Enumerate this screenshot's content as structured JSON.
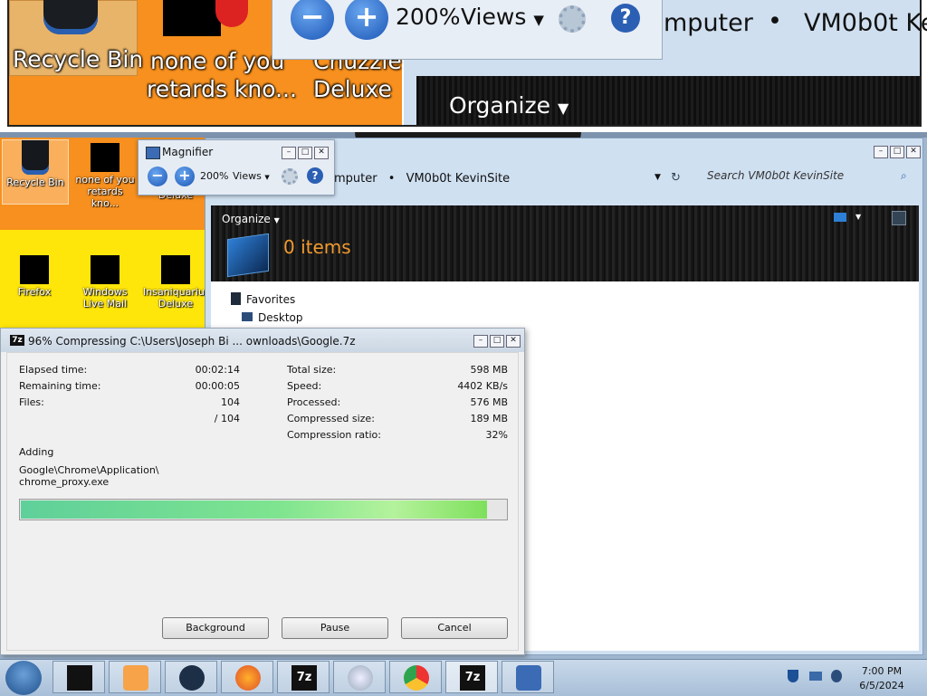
{
  "magnified": {
    "recycle_bin_label": "Recycle Bin",
    "none_of_you_label_1": "none of you",
    "none_of_you_label_2": "retards kno...",
    "chuzzle_label_1": "Chuzzle",
    "chuzzle_label_2": "Deluxe",
    "zoom": "200%",
    "views": "Views",
    "address_part": "mputer",
    "address_sep": "•",
    "address_site": "VM0b0t Ke",
    "organize": "Organize"
  },
  "desktop": {
    "icons": [
      {
        "label": "Recycle Bin"
      },
      {
        "label": "none of you retards kno..."
      },
      {
        "label": "Chuzzle Deluxe"
      },
      {
        "label": "Firefox"
      },
      {
        "label": "Windows Live Mail"
      },
      {
        "label": "Insaniquarium Deluxe"
      }
    ]
  },
  "magnifier": {
    "title": "Magnifier",
    "zoom": "200%",
    "views": "Views"
  },
  "explorer": {
    "address_part": "mputer",
    "address_sep": "•",
    "address_site": "VM0b0t KevinSite",
    "search_placeholder": "Search VM0b0t KevinSite",
    "organize": "Organize",
    "items_count": "0 items",
    "favorites": "Favorites",
    "desktop": "Desktop"
  },
  "zip": {
    "title": "96% Compressing C:\\Users\\Joseph Bi ... ownloads\\Google.7z",
    "elapsed_label": "Elapsed time:",
    "elapsed_value": "00:02:14",
    "remaining_label": "Remaining time:",
    "remaining_value": "00:00:05",
    "files_label": "Files:",
    "files_value": "104",
    "files_total": "/ 104",
    "total_size_label": "Total size:",
    "total_size_value": "598 MB",
    "speed_label": "Speed:",
    "speed_value": "4402 KB/s",
    "processed_label": "Processed:",
    "processed_value": "576 MB",
    "compressed_label": "Compressed size:",
    "compressed_value": "189 MB",
    "ratio_label": "Compression ratio:",
    "ratio_value": "32%",
    "action": "Adding",
    "path_line1": "Google\\Chrome\\Application\\",
    "path_line2": "chrome_proxy.exe",
    "progress": 0.96,
    "btn_background": "Background",
    "btn_pause": "Pause",
    "btn_cancel": "Cancel"
  },
  "taskbar": {
    "time": "7:00 PM",
    "date": "6/5/2024",
    "buttons": [
      "cmd-icon",
      "media-player-icon",
      "globe-icon",
      "firefox-icon",
      "7zip-icon",
      "cd-icon",
      "chrome-icon",
      "7zip-icon",
      "magnifier-icon"
    ]
  },
  "colors": {
    "accent_orange": "#f7901e",
    "desktop_yellow": "#ffe60a",
    "progress_green": "#6fdc8c",
    "items_orange": "#f19a2d"
  }
}
